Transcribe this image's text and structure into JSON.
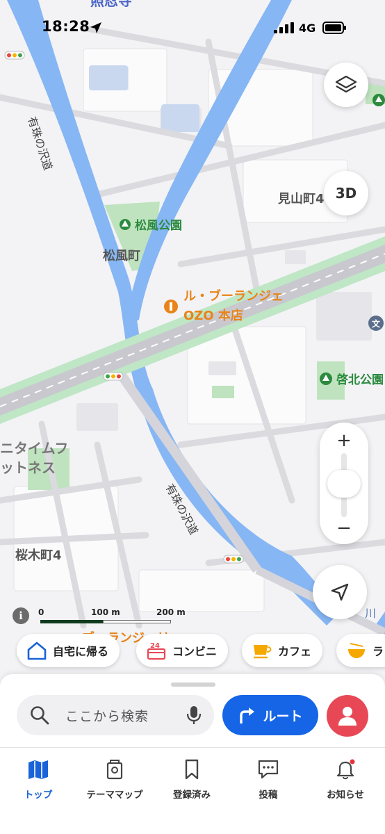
{
  "status_bar": {
    "time": "18:28",
    "network": "4G"
  },
  "map": {
    "labels": {
      "top_cut": "照忍寺",
      "road_north": "有珠の沢道",
      "road_south": "有珠の沢道",
      "park1": "松風公園",
      "town1": "松風町",
      "town2": "見山町4",
      "poi_line1": "ル・ブーランジェ",
      "poi_line2": "OZO 本店",
      "park2": "啓北公園",
      "gym_line1": "ニタイムフ",
      "gym_line2": "ットネス",
      "town3": "桜木町4",
      "river": "川",
      "bottom_cut": "ブーランジェリ"
    }
  },
  "controls": {
    "btn_3d": "3D",
    "zoom_in": "+",
    "zoom_out": "−"
  },
  "scale": {
    "zero": "0",
    "mid": "100 m",
    "end": "200 m"
  },
  "quick_chips": [
    {
      "label": "自宅に帰る",
      "icon": "home-icon"
    },
    {
      "label": "コンビニ",
      "icon": "convenience-store-icon"
    },
    {
      "label": "カフェ",
      "icon": "cafe-icon"
    },
    {
      "label": "ラ",
      "icon": "ramen-icon"
    }
  ],
  "search": {
    "placeholder": "ここから検索"
  },
  "route_button": "ルート",
  "tabs": [
    {
      "label": "トップ",
      "active": true
    },
    {
      "label": "テーママップ"
    },
    {
      "label": "登録済み"
    },
    {
      "label": "投稿"
    },
    {
      "label": "お知らせ"
    }
  ],
  "colors": {
    "accent": "#1565e6",
    "poi": "#e8841a",
    "park": "#2b8a3e",
    "river": "#86b6f4",
    "avatar": "#e84855"
  }
}
